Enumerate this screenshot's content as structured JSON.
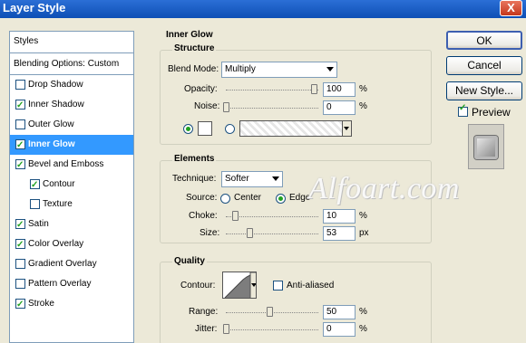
{
  "window": {
    "title": "Layer Style",
    "close_glyph": "X"
  },
  "styles_panel": {
    "header": "Styles",
    "blending": "Blending Options: Custom",
    "items": [
      {
        "label": "Drop Shadow",
        "checked": false
      },
      {
        "label": "Inner Shadow",
        "checked": true
      },
      {
        "label": "Outer Glow",
        "checked": false
      },
      {
        "label": "Inner Glow",
        "checked": true,
        "selected": true
      },
      {
        "label": "Bevel and Emboss",
        "checked": true
      },
      {
        "label": "Contour",
        "checked": true,
        "indent": true
      },
      {
        "label": "Texture",
        "checked": false,
        "indent": true
      },
      {
        "label": "Satin",
        "checked": true
      },
      {
        "label": "Color Overlay",
        "checked": true
      },
      {
        "label": "Gradient Overlay",
        "checked": false
      },
      {
        "label": "Pattern Overlay",
        "checked": false
      },
      {
        "label": "Stroke",
        "checked": true
      }
    ]
  },
  "inner_glow": {
    "title": "Inner Glow",
    "structure": {
      "legend": "Structure",
      "blend_mode_label": "Blend Mode:",
      "blend_mode": "Multiply",
      "opacity_label": "Opacity:",
      "opacity": "100",
      "opacity_unit": "%",
      "noise_label": "Noise:",
      "noise": "0",
      "noise_unit": "%"
    },
    "elements": {
      "legend": "Elements",
      "technique_label": "Technique:",
      "technique": "Softer",
      "source_label": "Source:",
      "source_center": "Center",
      "source_edge": "Edge",
      "choke_label": "Choke:",
      "choke": "10",
      "choke_unit": "%",
      "size_label": "Size:",
      "size": "53",
      "size_unit": "px"
    },
    "quality": {
      "legend": "Quality",
      "contour_label": "Contour:",
      "anti_aliased": "Anti-aliased",
      "range_label": "Range:",
      "range": "50",
      "range_unit": "%",
      "jitter_label": "Jitter:",
      "jitter": "0",
      "jitter_unit": "%"
    }
  },
  "buttons": {
    "ok": "OK",
    "cancel": "Cancel",
    "new_style": "New Style...",
    "preview": "Preview"
  },
  "watermark": "Alfoart.com"
}
